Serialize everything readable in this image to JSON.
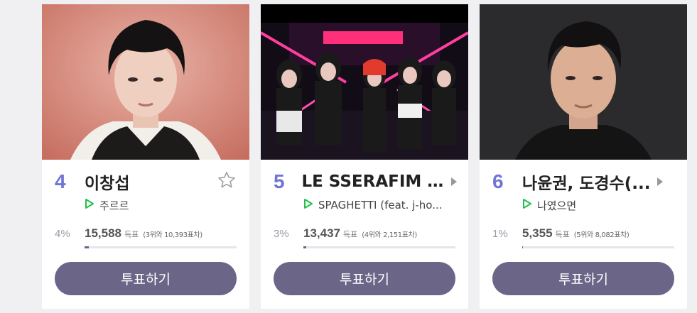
{
  "cards": [
    {
      "rank": "4",
      "artist": "이창섭",
      "song": "주르르",
      "percent": "4%",
      "votes": "15,588",
      "votes_unit": "득표",
      "gap_text": "(3위와 10,393표차)",
      "share": 0.04,
      "vote_label": "투표하기",
      "indicator_icon": "star-outline-icon"
    },
    {
      "rank": "5",
      "artist": "LE SSERAFIM (...",
      "song": "SPAGHETTI (feat. j-ho...",
      "percent": "3%",
      "votes": "13,437",
      "votes_unit": "득표",
      "gap_text": "(4위와 2,151표차)",
      "share": 0.03,
      "vote_label": "투표하기",
      "indicator_icon": "chevron-right-icon"
    },
    {
      "rank": "6",
      "artist": "나윤권, 도경수(...",
      "song": "나였으면",
      "percent": "1%",
      "votes": "5,355",
      "votes_unit": "득표",
      "gap_text": "(5위와 8,082표차)",
      "share": 0.01,
      "vote_label": "투표하기",
      "indicator_icon": "chevron-right-icon"
    }
  ],
  "colors": {
    "rank": "#6f74d6",
    "button": "#6b6688",
    "play_icon": "#22c04a"
  }
}
